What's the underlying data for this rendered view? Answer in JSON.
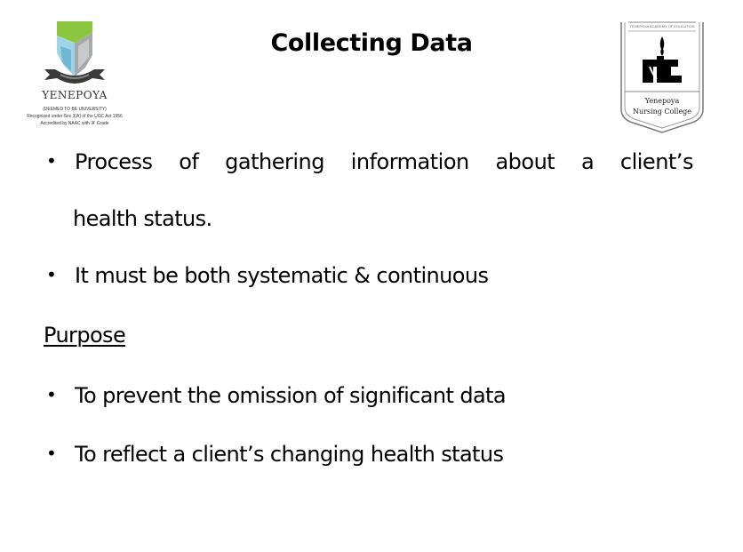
{
  "slide": {
    "title": "Collecting Data",
    "logo_left": {
      "icon": "yenepoya-university-shield-logo",
      "name": "YENEPOYA",
      "line1": "(DEEMED TO BE UNIVERSITY)",
      "line2": "Recognized under Sec 3(A) of the UGC Act 1956",
      "line3": "Accredited by NAAC with 'A' Grade",
      "colors": {
        "green": "#8cc63f",
        "lightblue": "#9fd3e6",
        "blue": "#6fb7d2",
        "grey": "#a7a9ac",
        "ribbon": "#3a3a3a"
      }
    },
    "logo_right": {
      "icon": "yenepoya-nursing-college-crest-logo",
      "top_text": "YENEPOYA ACADEMY OF EDUCATION",
      "name_line1": "Yenepoya",
      "name_line2": "Nursing College"
    },
    "bullets": [
      {
        "words": [
          "Process",
          "of",
          "gathering",
          "information",
          "about",
          "a",
          "client’s"
        ],
        "continuation": "health status."
      },
      {
        "text": "It must be both systematic & continuous"
      }
    ],
    "purpose_heading": "Purpose",
    "purpose_bullets": [
      {
        "text": "To prevent the omission of significant data"
      },
      {
        "text": "To reflect a client’s changing health status"
      }
    ],
    "bullet_glyph": "•"
  }
}
